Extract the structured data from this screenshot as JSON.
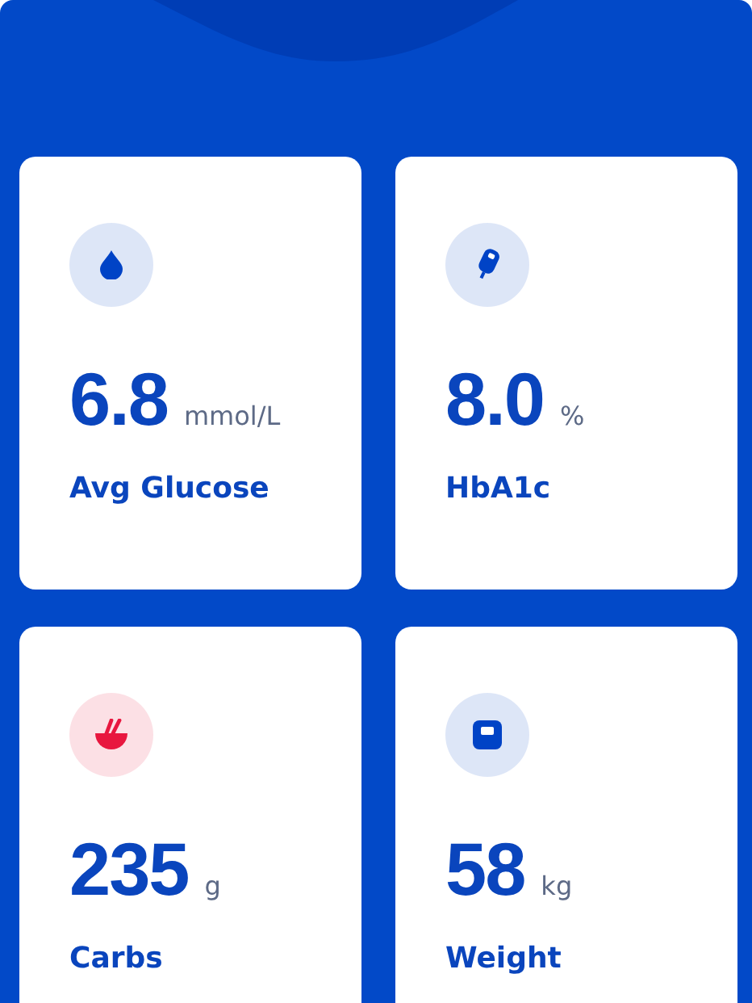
{
  "metrics": [
    {
      "kind": "drop",
      "color": "#0043c6",
      "value": "6.8",
      "unit": "mmol/L",
      "label": "Avg Glucose"
    },
    {
      "kind": "meter",
      "color": "#0043c6",
      "value": "8.0",
      "unit": "%",
      "label": "HbA1c"
    },
    {
      "kind": "bowl",
      "color": "#e8173f",
      "value": "235",
      "unit": "g",
      "label": "Carbs"
    },
    {
      "kind": "scale",
      "color": "#0043c6",
      "value": "58",
      "unit": "kg",
      "label": "Weight"
    }
  ]
}
